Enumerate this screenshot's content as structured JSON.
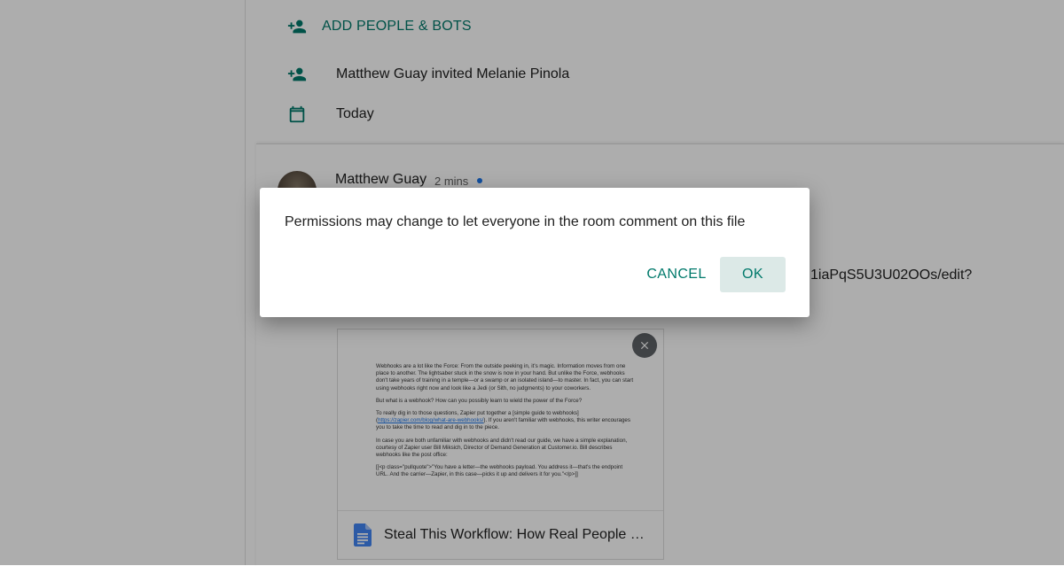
{
  "colors": {
    "accent": "#00796b",
    "status_online": "#1a73e8",
    "ok_button_bg": "#dce9e7"
  },
  "room_info": {
    "add_people": {
      "icon": "person-add-icon",
      "label": "ADD PEOPLE & BOTS"
    },
    "invite": {
      "icon": "person-add-icon",
      "text": "Matthew Guay invited Melanie Pinola"
    },
    "date": {
      "icon": "calendar-icon",
      "text": "Today"
    }
  },
  "message": {
    "author": "Matthew Guay",
    "time": "2 mins",
    "link_fragment": "1iaPqS5U3U02OOs/edit?"
  },
  "attachment": {
    "body_paragraphs": [
      "Webhooks are a lot like the Force: From the outside peeking in, it's magic. Information moves from one place to another. The lightsaber stuck in the snow is now in your hand. But unlike the Force, webhooks don't take years of training in a temple—or a swamp or an isolated island—to master. In fact, you can start using webhooks right now and look like a Jedi (or Sith, no judgments) to your coworkers.",
      "But what is a webhook? How can you possibly learn to wield the power of the Force?",
      "In case you are both unfamiliar with webhooks and didn't read our guide, we have a simple explanation, courtesy of Zapier user Bill Miksich, Director of Demand Generation at Customer.io. Bill describes webhooks like the post office:",
      "[[<p class=\"pullquote\">\"You have a letter—the webhooks payload. You address it—that's the endpoint URL. And the carrier—Zapier, in this case—picks it up and delivers it for you.\"</p>]]"
    ],
    "guide_paragraph": {
      "before": "To really dig in to those questions, Zapier put together a [simple guide to webhooks](",
      "link": "https://zapier.com/blog/what-are-webhooks/",
      "after": "). If you aren't familiar with webhooks, this writer encourages you to take the time to read and dig in to the piece."
    },
    "title": "Steal This Workflow: How Real People Use Webhooks",
    "file_icon": "google-docs-icon",
    "remove_icon": "close-icon"
  },
  "dialog": {
    "message": "Permissions may change to let everyone in the room comment on this file",
    "cancel_label": "CANCEL",
    "ok_label": "OK"
  }
}
